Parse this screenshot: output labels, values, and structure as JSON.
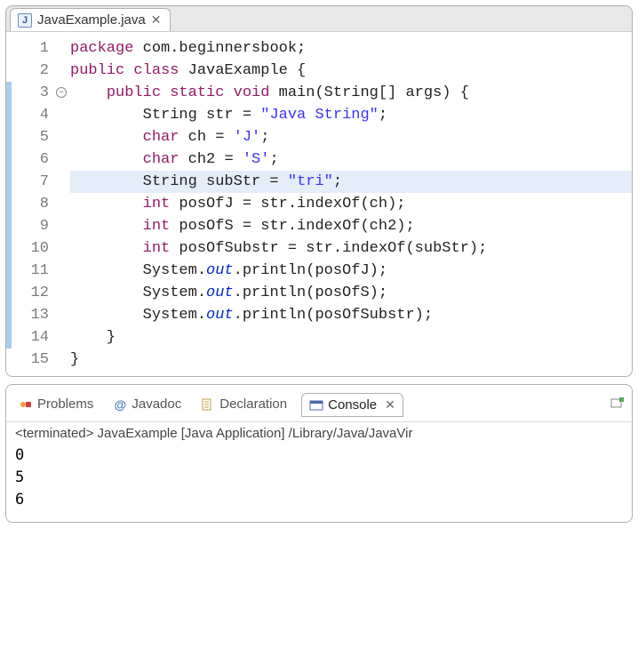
{
  "editor": {
    "tab": {
      "filename": "JavaExample.java"
    },
    "highlighted_line_index": 6,
    "line_numbers": [
      "1",
      "2",
      "3",
      "4",
      "5",
      "6",
      "7",
      "8",
      "9",
      "10",
      "11",
      "12",
      "13",
      "14",
      "15"
    ],
    "fold_row": 2,
    "marker_start_row": 2,
    "marker_end_row": 13,
    "lines": [
      [
        [
          "kw",
          "package"
        ],
        [
          "pkg",
          " com.beginnersbook;"
        ]
      ],
      [
        [
          "kw",
          "public class"
        ],
        [
          "",
          " JavaExample {"
        ]
      ],
      [
        [
          "",
          "    "
        ],
        [
          "kw",
          "public static void"
        ],
        [
          "",
          " main(String[] args) {"
        ]
      ],
      [
        [
          "",
          "        String str = "
        ],
        [
          "str",
          "\"Java String\""
        ],
        [
          "",
          ";"
        ]
      ],
      [
        [
          "",
          "        "
        ],
        [
          "kw",
          "char"
        ],
        [
          "",
          " ch = "
        ],
        [
          "str",
          "'J'"
        ],
        [
          "",
          ";"
        ]
      ],
      [
        [
          "",
          "        "
        ],
        [
          "kw",
          "char"
        ],
        [
          "",
          " ch2 = "
        ],
        [
          "str",
          "'S'"
        ],
        [
          "",
          ";"
        ]
      ],
      [
        [
          "",
          "        String subStr = "
        ],
        [
          "str",
          "\"tri\""
        ],
        [
          "",
          ";"
        ]
      ],
      [
        [
          "",
          "        "
        ],
        [
          "kw",
          "int"
        ],
        [
          "",
          " posOfJ = str.indexOf(ch);"
        ]
      ],
      [
        [
          "",
          "        "
        ],
        [
          "kw",
          "int"
        ],
        [
          "",
          " posOfS = str.indexOf(ch2);"
        ]
      ],
      [
        [
          "",
          "        "
        ],
        [
          "kw",
          "int"
        ],
        [
          "",
          " posOfSubstr = str.indexOf(subStr);"
        ]
      ],
      [
        [
          "",
          "        System."
        ],
        [
          "fld",
          "out"
        ],
        [
          "",
          ".println(posOfJ);"
        ]
      ],
      [
        [
          "",
          "        System."
        ],
        [
          "fld",
          "out"
        ],
        [
          "",
          ".println(posOfS);"
        ]
      ],
      [
        [
          "",
          "        System."
        ],
        [
          "fld",
          "out"
        ],
        [
          "",
          ".println(posOfSubstr);"
        ]
      ],
      [
        [
          "",
          "    }"
        ]
      ],
      [
        [
          "",
          "}"
        ]
      ]
    ]
  },
  "bottom": {
    "tabs": {
      "problems": "Problems",
      "javadoc": "Javadoc",
      "declaration": "Declaration",
      "console": "Console"
    },
    "status": "<terminated> JavaExample [Java Application] /Library/Java/JavaVir",
    "output": [
      "0",
      "5",
      "6"
    ]
  }
}
